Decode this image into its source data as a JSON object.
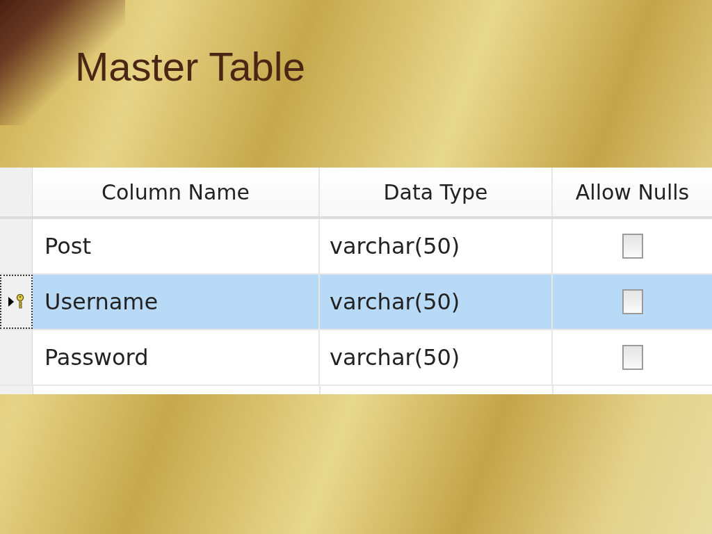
{
  "title": "Master Table",
  "table": {
    "columns": [
      "Column Name",
      "Data Type",
      "Allow Nulls"
    ],
    "rows": [
      {
        "name": "Post",
        "type": "varchar(50)",
        "allow_nulls": false,
        "selected": false,
        "primary_key": false
      },
      {
        "name": "Username",
        "type": "varchar(50)",
        "allow_nulls": false,
        "selected": true,
        "primary_key": true
      },
      {
        "name": "Password",
        "type": "varchar(50)",
        "allow_nulls": false,
        "selected": false,
        "primary_key": false
      }
    ]
  }
}
